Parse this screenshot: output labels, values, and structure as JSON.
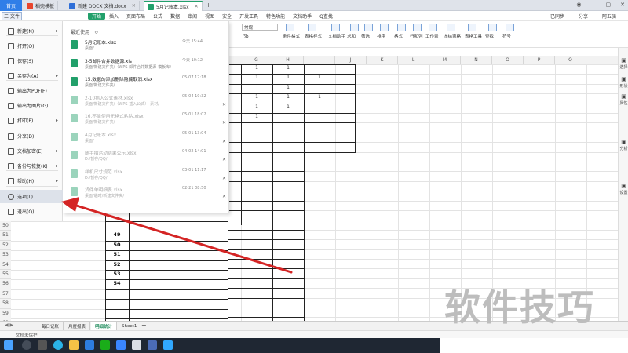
{
  "tabs": {
    "home": "首页",
    "template": "稻壳模板",
    "doc": "新建 DOCX 文档.docx",
    "xlsx": "5月记账本.xlsx",
    "add": "+"
  },
  "ribbon": {
    "file": "三 文件",
    "items": [
      "开始",
      "插入",
      "页面布局",
      "公式",
      "数据",
      "审阅",
      "视图",
      "安全",
      "开发工具",
      "特色功能",
      "文档助手",
      "Q查找"
    ],
    "right": [
      "已同步",
      "分享",
      "阿五骑"
    ]
  },
  "toolbar": {
    "numfmt": "常规",
    "pct": "%",
    "buttons": [
      "条件格式",
      "表格样式",
      "文档助手",
      "求和",
      "筛选",
      "排序",
      "格式",
      "行和列",
      "工作表",
      "冻结窗格",
      "表格工具",
      "查找",
      "符号"
    ]
  },
  "columns": [
    "G",
    "H",
    "I",
    "J",
    "K",
    "L",
    "M",
    "N",
    "O",
    "P",
    "Q"
  ],
  "grid_ones": [
    {
      "col": "G",
      "row": 0,
      "v": "1"
    },
    {
      "col": "H",
      "row": 0,
      "v": "1"
    },
    {
      "col": "G",
      "row": 1,
      "v": "1"
    },
    {
      "col": "H",
      "row": 1,
      "v": "1"
    },
    {
      "col": "I",
      "row": 1,
      "v": "1"
    },
    {
      "col": "H",
      "row": 2,
      "v": "1"
    },
    {
      "col": "G",
      "row": 3,
      "v": "1"
    },
    {
      "col": "H",
      "row": 3,
      "v": "1"
    },
    {
      "col": "I",
      "row": 3,
      "v": "1"
    },
    {
      "col": "G",
      "row": 4,
      "v": "1"
    },
    {
      "col": "H",
      "row": 4,
      "v": "1"
    },
    {
      "col": "G",
      "row": 5,
      "v": "1"
    }
  ],
  "menu": {
    "items": [
      {
        "label": "新建(N)",
        "arrow": true
      },
      {
        "label": "打开(O)",
        "arrow": false
      },
      {
        "label": "保存(S)",
        "arrow": false
      },
      {
        "label": "另存为(A)",
        "arrow": true
      },
      {
        "label": "输出为PDF(F)",
        "arrow": false
      },
      {
        "label": "输出为图片(G)",
        "arrow": false
      },
      {
        "label": "打印(P)",
        "arrow": true
      },
      {
        "label": "分享(D)",
        "arrow": false
      },
      {
        "label": "文档加密(E)",
        "arrow": true
      },
      {
        "label": "备份与恢复(K)",
        "arrow": true
      },
      {
        "label": "帮助(H)",
        "arrow": true
      },
      {
        "label": "选项(L)",
        "arrow": false
      },
      {
        "label": "退出(Q)",
        "arrow": false
      }
    ],
    "selected_label": "选项(L)"
  },
  "recent": {
    "header": "最近使用",
    "files": [
      {
        "name": "5月记账本.xlsx",
        "path": "桌面/",
        "date": "今天 15:44",
        "color": "#22a06b",
        "dim": false
      },
      {
        "name": "3-5邮件合并数据源.xls",
        "path": "桌面/新建文件夹/（WPS-邮件合并数据源-模板库）",
        "date": "今天 10:12",
        "color": "#22a06b",
        "dim": false
      },
      {
        "name": "15.数据的添加删除隐藏取消.xlsx",
        "path": "桌面/新建文件夹/",
        "date": "05-07 12:18",
        "color": "#22a06b",
        "dim": false
      },
      {
        "name": "2-10插入公式素材.xlsx",
        "path": "桌面/新建文件夹/（WPS-插入公式）-素材/",
        "date": "05-04 10:32",
        "color": "#22a06b",
        "dim": true
      },
      {
        "name": "16.不能使用无格式粘贴.xlsx",
        "path": "桌面/新建文件夹/",
        "date": "05-01 18:02",
        "color": "#22a06b",
        "dim": true
      },
      {
        "name": "4月记账本.xlsx",
        "path": "桌面/",
        "date": "05-01 13:04",
        "color": "#22a06b",
        "dim": true
      },
      {
        "name": "随手拍活动结果公示.xlsx",
        "path": "D:/暂存/QQ/",
        "date": "04-02 14:01",
        "color": "#22a06b",
        "dim": true
      },
      {
        "name": "样机尺寸规范.xlsx",
        "path": "D:/暂存/QQ/",
        "date": "03-01 11:17",
        "color": "#22a06b",
        "dim": true
      },
      {
        "name": "货件单明细表.xlsx",
        "path": "桌面/临时/新建文件夹/",
        "date": "02-21 08:50",
        "color": "#22a06b",
        "dim": true
      }
    ]
  },
  "lower_rows": {
    "row_numbers": [
      "50",
      "51",
      "52",
      "53",
      "54",
      "55",
      "56",
      "57",
      "58",
      "59",
      "60"
    ],
    "cell_values": [
      "49",
      "50",
      "51",
      "52",
      "53",
      "54"
    ]
  },
  "sidebar": [
    "选择",
    "形状",
    "属性",
    "分析",
    "设置"
  ],
  "sheet_tabs": {
    "tabs": [
      "每日记账",
      "月度报表",
      "明细统计",
      "Sheet1"
    ],
    "active": "明细统计",
    "add": "+"
  },
  "status": {
    "text": "文档未保护"
  },
  "watermark": "软件技巧",
  "colors": {
    "accent_green": "#22a06b",
    "home_blue": "#2f7ee8",
    "arrow_red": "#d42424"
  }
}
